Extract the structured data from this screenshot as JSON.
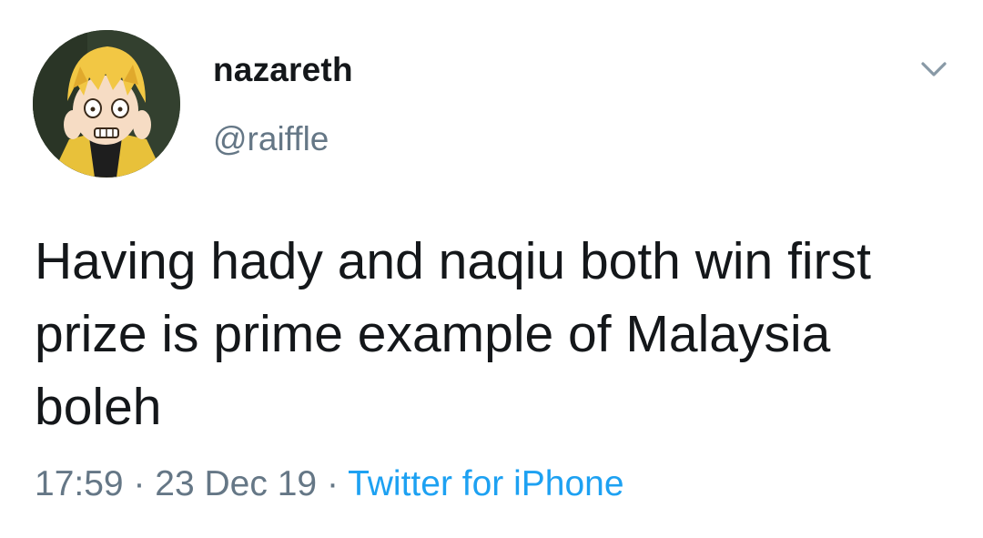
{
  "user": {
    "display_name": "nazareth",
    "handle": "@raiffle"
  },
  "tweet": {
    "text": "Having hady and naqiu both win first prize is prime example of Malaysia boleh",
    "time": "17:59",
    "date": "23 Dec 19",
    "separator": "·",
    "source": "Twitter for iPhone"
  },
  "icons": {
    "menu": "chevron-down-icon"
  },
  "colors": {
    "text": "#14171a",
    "secondary": "#657786",
    "link": "#1da1f2"
  }
}
